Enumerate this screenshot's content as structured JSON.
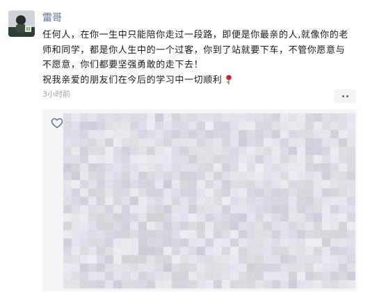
{
  "post": {
    "author": "雷哥",
    "lines": [
      "任何人，在你一生中只能陪你走过一段路，即便是你最亲的人,就像你的老",
      "师和同学，都是你人生中的一个过客，你到了站就要下车，不管你愿意与",
      "不愿意，你们都要坚强勇敢的走下去！",
      "祝我亲爱的朋友们在今后的学习中一切顺利"
    ],
    "emoji": "rose-icon",
    "time": "3小时前"
  },
  "likes": {
    "icon": "heart-outline-icon",
    "content": "pixelated"
  },
  "colors": {
    "name": "#576b95",
    "text": "#1a1a1a",
    "time": "#a3a3a3",
    "panel": "#f5f5f6"
  }
}
